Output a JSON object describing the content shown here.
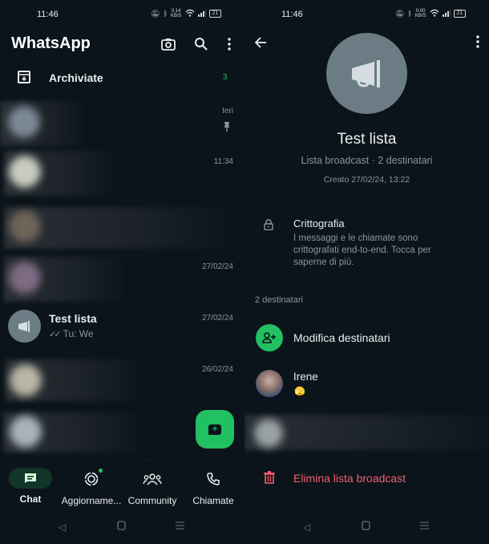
{
  "colors": {
    "background": "#0b141a",
    "accent": "#21c063",
    "danger": "#f15c6d",
    "muted": "#8696a0",
    "avatar_placeholder": "#6b7c85"
  },
  "left": {
    "status": {
      "time": "11:46",
      "net_speed": "0.14",
      "net_unit": "KB/S",
      "battery": "21"
    },
    "appbar": {
      "title": "WhatsApp",
      "icons": [
        "camera-icon",
        "search-icon",
        "more-vert-icon"
      ]
    },
    "archived": {
      "label": "Archiviate",
      "count": "3"
    },
    "chats": [
      {
        "name": "",
        "preview": "",
        "time": "Ieri",
        "pinned": true,
        "blurred": true
      },
      {
        "name": "",
        "preview": "",
        "time": "11:34",
        "pinned": false,
        "blurred": true
      },
      {
        "name": "",
        "preview": "",
        "time": "",
        "pinned": false,
        "blurred": true
      },
      {
        "name": "",
        "preview": "",
        "time": "27/02/24",
        "pinned": false,
        "blurred": true
      },
      {
        "name": "Test lista",
        "preview": "Tu: We",
        "time": "27/02/24",
        "pinned": false,
        "blurred": false
      },
      {
        "name": "",
        "preview": "",
        "time": "26/02/24",
        "pinned": false,
        "blurred": true
      },
      {
        "name": "",
        "preview": "",
        "time": "",
        "pinned": false,
        "blurred": true
      }
    ],
    "fab": {
      "icon": "new-chat-icon"
    },
    "bottom_nav": [
      {
        "label": "Chat",
        "icon": "chat-icon",
        "active": true
      },
      {
        "label": "Aggiorname...",
        "icon": "updates-icon",
        "active": false,
        "badge_dot": true
      },
      {
        "label": "Community",
        "icon": "community-icon",
        "active": false
      },
      {
        "label": "Chiamate",
        "icon": "phone-icon",
        "active": false
      }
    ]
  },
  "right": {
    "status": {
      "time": "11:46",
      "net_speed": "0.00",
      "net_unit": "KB/S",
      "battery": "21"
    },
    "title": "Test lista",
    "subtitle": "Lista broadcast · 2 destinatari",
    "created": "Creato 27/02/24, 13:22",
    "encryption": {
      "title": "Crittografia",
      "description": "I messaggi e le chiamate sono crittografati end-to-end. Tocca per saperne di più."
    },
    "recipients_label": "2 destinatari",
    "edit_recipients": "Modifica destinatari",
    "members": [
      {
        "name": "Irene",
        "status": "🫣"
      },
      {
        "name": "",
        "status": "",
        "blurred": true
      }
    ],
    "delete_label": "Elimina lista broadcast"
  }
}
